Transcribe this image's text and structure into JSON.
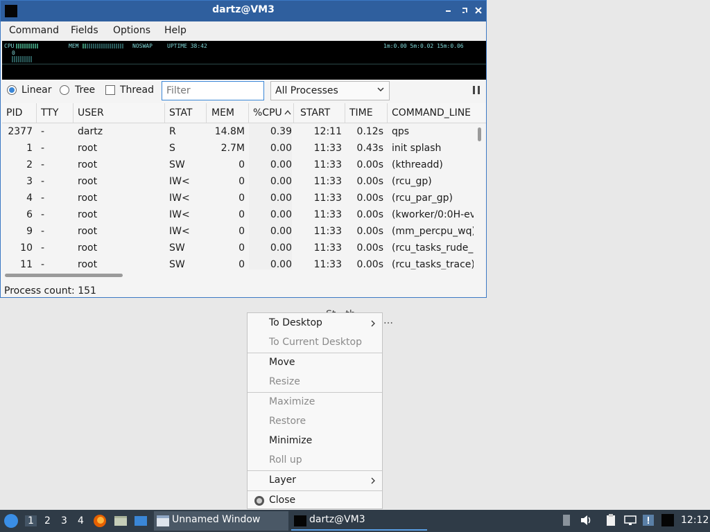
{
  "window": {
    "title": "dartz@VM3",
    "menu": [
      "Command",
      "Fields",
      "Options",
      "Help"
    ]
  },
  "graph": {
    "cpu_label": "CPU",
    "mem_label": "MEM",
    "swap_label": "NOSWAP",
    "uptime": "UPTIME 38:42",
    "load": "1m:0.00 5m:0.02 15m:0.06",
    "zero": "0"
  },
  "toolbar": {
    "linear": "Linear",
    "tree": "Tree",
    "thread": "Thread",
    "filter_placeholder": "Filter",
    "processes": "All Processes"
  },
  "table": {
    "columns": [
      "PID",
      "TTY",
      "USER",
      "STAT",
      "MEM",
      "%CPU",
      "START",
      "TIME",
      "COMMAND_LINE"
    ],
    "rows": [
      [
        "2377",
        "-",
        "dartz",
        "R",
        "14.8M",
        "0.39",
        "12:11",
        "0.12s",
        "qps"
      ],
      [
        "1",
        "-",
        "root",
        "S",
        "2.7M",
        "0.00",
        "11:33",
        "0.43s",
        "init splash"
      ],
      [
        "2",
        "-",
        "root",
        "SW",
        "0",
        "0.00",
        "11:33",
        "0.00s",
        "(kthreadd)"
      ],
      [
        "3",
        "-",
        "root",
        "IW<",
        "0",
        "0.00",
        "11:33",
        "0.00s",
        "(rcu_gp)"
      ],
      [
        "4",
        "-",
        "root",
        "IW<",
        "0",
        "0.00",
        "11:33",
        "0.00s",
        "(rcu_par_gp)"
      ],
      [
        "6",
        "-",
        "root",
        "IW<",
        "0",
        "0.00",
        "11:33",
        "0.00s",
        "(kworker/0:0H-ev"
      ],
      [
        "9",
        "-",
        "root",
        "IW<",
        "0",
        "0.00",
        "11:33",
        "0.00s",
        "(mm_percpu_wq)"
      ],
      [
        "10",
        "-",
        "root",
        "SW",
        "0",
        "0.00",
        "11:33",
        "0.00s",
        "(rcu_tasks_rude_)"
      ],
      [
        "11",
        "-",
        "root",
        "SW",
        "0",
        "0.00",
        "11:33",
        "0.00s",
        "(rcu_tasks_trace)"
      ]
    ]
  },
  "status": "Process count: 151",
  "context_menu": {
    "items": [
      {
        "label": "To Desktop",
        "disabled": false
      },
      {
        "label": "To Current Desktop",
        "disabled": true
      },
      {
        "label": "Move",
        "disabled": false
      },
      {
        "label": "Resize",
        "disabled": true
      },
      {
        "label": "Maximize",
        "disabled": true
      },
      {
        "label": "Restore",
        "disabled": true
      },
      {
        "label": "Minimize",
        "disabled": false
      },
      {
        "label": "Roll up",
        "disabled": true
      },
      {
        "label": "Layer",
        "disabled": false
      },
      {
        "label": "Close",
        "disabled": false
      }
    ]
  },
  "background_fragments": {
    "a": "St…th…",
    "b": "…"
  },
  "taskbar": {
    "workspaces": [
      "1",
      "2",
      "3",
      "4"
    ],
    "tasks": [
      "Unnamed Window",
      "dartz@VM3"
    ],
    "clock": "12:12"
  },
  "colors": {
    "accent": "#3a86d6",
    "titlebar": "#2f5f9e",
    "taskbar": "#2f3b47"
  }
}
